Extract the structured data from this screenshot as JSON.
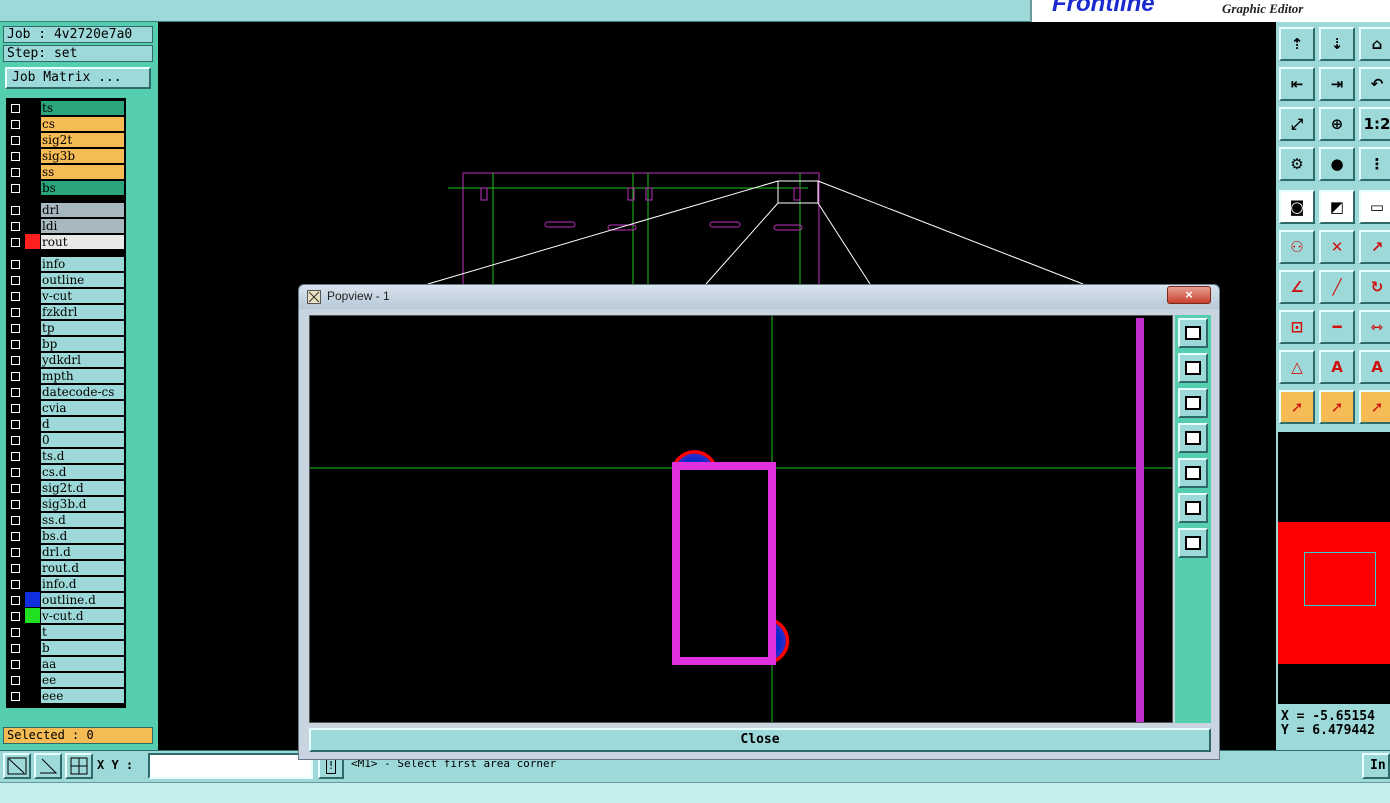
{
  "app": {
    "brand": "Frontline",
    "subtitle": "Graphic Editor"
  },
  "job": {
    "job_label": "Job : 4v2720e7a0",
    "step_label": "Step: set",
    "matrix_button": "Job Matrix ..."
  },
  "layers": [
    {
      "name": "ts",
      "color": "#2aa57d",
      "swatch": ""
    },
    {
      "name": "cs",
      "color": "#f5bb55",
      "swatch": ""
    },
    {
      "name": "sig2t",
      "color": "#f5bb55",
      "swatch": ""
    },
    {
      "name": "sig3b",
      "color": "#f5bb55",
      "swatch": ""
    },
    {
      "name": "ss",
      "color": "#f5bb55",
      "swatch": ""
    },
    {
      "name": "bs",
      "color": "#2aa57d",
      "swatch": ""
    },
    {
      "name": "drl",
      "color": "#a8b8c0",
      "swatch": ""
    },
    {
      "name": "ldi",
      "color": "#a8b8c0",
      "swatch": ""
    },
    {
      "name": "rout",
      "color": "#e8e8e8",
      "swatch": "#ff2020"
    },
    {
      "name": "info",
      "color": "#9dd9d9",
      "swatch": ""
    },
    {
      "name": "outline",
      "color": "#9dd9d9",
      "swatch": ""
    },
    {
      "name": "v-cut",
      "color": "#9dd9d9",
      "swatch": ""
    },
    {
      "name": "fzkdrl",
      "color": "#9dd9d9",
      "swatch": ""
    },
    {
      "name": "tp",
      "color": "#9dd9d9",
      "swatch": ""
    },
    {
      "name": "bp",
      "color": "#9dd9d9",
      "swatch": ""
    },
    {
      "name": "ydkdrl",
      "color": "#9dd9d9",
      "swatch": ""
    },
    {
      "name": "mpth",
      "color": "#9dd9d9",
      "swatch": ""
    },
    {
      "name": "datecode-cs",
      "color": "#9dd9d9",
      "swatch": ""
    },
    {
      "name": "cvia",
      "color": "#9dd9d9",
      "swatch": ""
    },
    {
      "name": "d",
      "color": "#9dd9d9",
      "swatch": ""
    },
    {
      "name": "0",
      "color": "#9dd9d9",
      "swatch": ""
    },
    {
      "name": "ts.d",
      "color": "#9dd9d9",
      "swatch": ""
    },
    {
      "name": "cs.d",
      "color": "#9dd9d9",
      "swatch": ""
    },
    {
      "name": "sig2t.d",
      "color": "#9dd9d9",
      "swatch": ""
    },
    {
      "name": "sig3b.d",
      "color": "#9dd9d9",
      "swatch": ""
    },
    {
      "name": "ss.d",
      "color": "#9dd9d9",
      "swatch": ""
    },
    {
      "name": "bs.d",
      "color": "#9dd9d9",
      "swatch": ""
    },
    {
      "name": "drl.d",
      "color": "#9dd9d9",
      "swatch": ""
    },
    {
      "name": "rout.d",
      "color": "#9dd9d9",
      "swatch": ""
    },
    {
      "name": "info.d",
      "color": "#9dd9d9",
      "swatch": ""
    },
    {
      "name": "outline.d",
      "color": "#9dd9d9",
      "swatch": "#1030e0"
    },
    {
      "name": "v-cut.d",
      "color": "#9dd9d9",
      "swatch": "#20e020"
    },
    {
      "name": "t",
      "color": "#9dd9d9",
      "swatch": ""
    },
    {
      "name": "b",
      "color": "#9dd9d9",
      "swatch": ""
    },
    {
      "name": "aa",
      "color": "#9dd9d9",
      "swatch": ""
    },
    {
      "name": "ee",
      "color": "#9dd9d9",
      "swatch": ""
    },
    {
      "name": "eee",
      "color": "#9dd9d9",
      "swatch": ""
    }
  ],
  "selected_label": "Selected : 0",
  "popup": {
    "title": "Popview - 1",
    "close_x": "×",
    "close_button": "Close"
  },
  "coordinates": {
    "x": "X = -5.65154",
    "y": "Y = 6.479442"
  },
  "bottom": {
    "xy_label": "X Y :",
    "xy_value": "",
    "message": "<M1> - Select first area corner",
    "right_button": "In"
  },
  "icons": {
    "right_toolbar": [
      "zoom-top-icon",
      "zoom-bottom-icon",
      "home-icon",
      "pan-left-icon",
      "pan-right-icon",
      "undo-icon",
      "fit-all-icon",
      "fit-center-icon",
      "scale-1-2-icon",
      "measure-tools-icon",
      "snap-icon",
      "netlist-icon",
      "feature-select-icon",
      "highlight-icon",
      "ruler-icon",
      "connect-icon",
      "intersect-icon",
      "extend-icon",
      "angle-icon",
      "line-icon",
      "arc-icon",
      "move-icon",
      "cut-icon",
      "resize-icon",
      "triangle-icon",
      "arrow-up-icon",
      "arrow-a-icon",
      "pointer-icon",
      "pointer-box-icon",
      "pointer-rotate-icon"
    ],
    "popup_tools": [
      "zoom-window-icon",
      "zoom-top-icon",
      "zoom-bottom-icon",
      "pan-left-icon",
      "pan-right-icon",
      "fit-all-icon",
      "fit-center-icon"
    ]
  }
}
